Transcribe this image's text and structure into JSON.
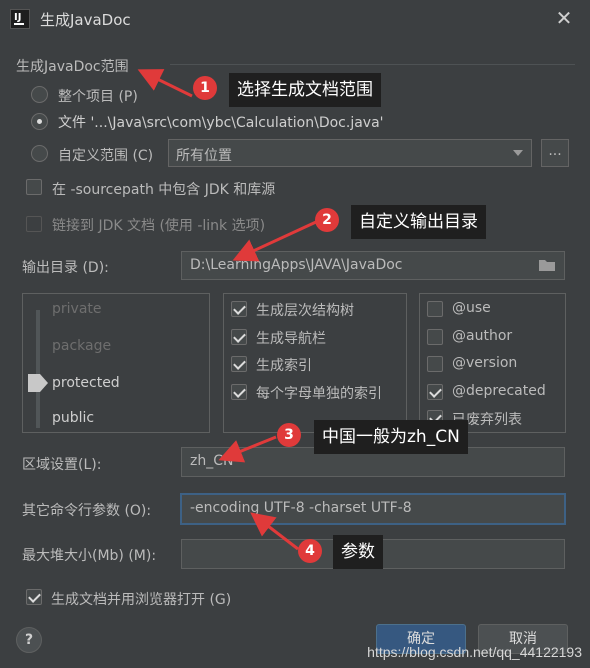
{
  "window": {
    "title": "生成JavaDoc",
    "icon_letters": "IJ"
  },
  "scope": {
    "title": "生成JavaDoc范围",
    "options": [
      {
        "label": "整个项目 (P)",
        "selected": false
      },
      {
        "label": "文件 '...\\Java\\src\\com\\ybc\\Calculation\\Doc.java'",
        "selected": true
      },
      {
        "label": "自定义范围 (C)",
        "selected": false
      }
    ],
    "custom_scope_value": "所有位置",
    "more_button": "...",
    "include_jdk": {
      "label": "在 -sourcepath 中包含 JDK 和库源",
      "checked": false
    },
    "link_jdk": {
      "label": "链接到 JDK 文档 (使用 -link 选项)",
      "checked": false,
      "disabled": true
    }
  },
  "output_dir": {
    "label": "输出目录 (D):",
    "value": "D:\\LearningApps\\JAVA\\JavaDoc"
  },
  "visibility": {
    "levels": [
      "private",
      "package",
      "protected",
      "public"
    ],
    "selected": "protected"
  },
  "options": [
    {
      "label": "生成层次结构树",
      "checked": true
    },
    {
      "label": "生成导航栏",
      "checked": true
    },
    {
      "label": "生成索引",
      "checked": true
    },
    {
      "label": "每个字母单独的索引",
      "checked": true
    }
  ],
  "tags": [
    {
      "label": "@use",
      "checked": false
    },
    {
      "label": "@author",
      "checked": false
    },
    {
      "label": "@version",
      "checked": false
    },
    {
      "label": "@deprecated",
      "checked": true
    },
    {
      "label": "已废弃列表",
      "checked": true
    }
  ],
  "locale": {
    "label": "区域设置(L):",
    "value": "zh_CN"
  },
  "cmd_args": {
    "label": "其它命令行参数 (O):",
    "value": "-encoding UTF-8 -charset UTF-8"
  },
  "heap": {
    "label": "最大堆大小(Mb) (M):",
    "value": ""
  },
  "open_browser": {
    "label": "生成文档并用浏览器打开 (G)",
    "checked": true
  },
  "buttons": {
    "ok": "确定",
    "cancel": "取消",
    "help": "?"
  },
  "annotations": [
    {
      "number": "1",
      "text": "选择生成文档范围"
    },
    {
      "number": "2",
      "text": "自定义输出目录"
    },
    {
      "number": "3",
      "text": "中国一般为zh_CN"
    },
    {
      "number": "4",
      "text": "参数"
    }
  ],
  "watermark": "https://blog.csdn.net/qq_44122193",
  "colors": {
    "background": "#3c3f41",
    "accent": "#365880",
    "annotation_red": "#e03a3a",
    "callout_bg": "#1f1f1f"
  }
}
